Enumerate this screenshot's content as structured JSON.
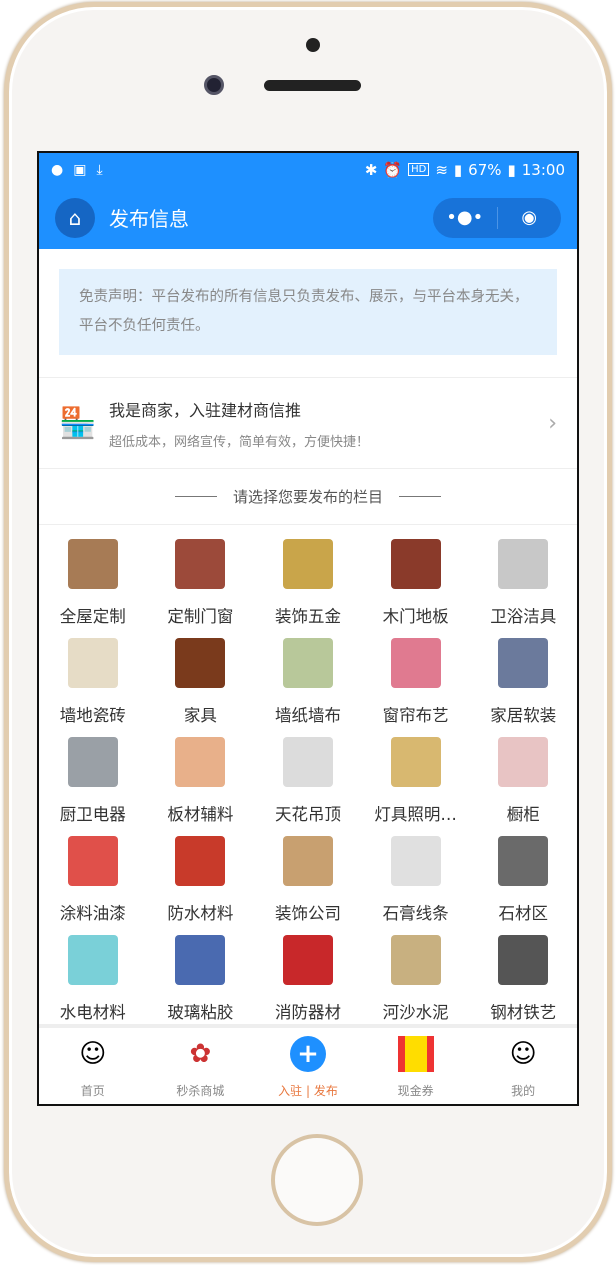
{
  "status": {
    "time": "13:00",
    "battery": "67%",
    "icons": [
      "wechat-icon",
      "image-icon",
      "download-icon",
      "bluetooth-icon",
      "alarm-icon",
      "hd-icon",
      "wifi-icon",
      "signal-icon",
      "battery-icon"
    ]
  },
  "nav": {
    "title": "发布信息",
    "more": "•●•",
    "target": "◉"
  },
  "disclaimer": "免责声明：平台发布的所有信息只负责发布、展示，与平台本身无关，平台不负任何责任。",
  "merchant": {
    "title": "我是商家，入驻建材商信推",
    "subtitle": "超低成本，网络宣传，简单有效，方便快捷！"
  },
  "section_title": "请选择您要发布的栏目",
  "categories": [
    {
      "label": "全屋定制",
      "color": "#a77b55"
    },
    {
      "label": "定制门窗",
      "color": "#9c4a3a"
    },
    {
      "label": "装饰五金",
      "color": "#c9a54a"
    },
    {
      "label": "木门地板",
      "color": "#8a3a2a"
    },
    {
      "label": "卫浴洁具",
      "color": "#c8c8c8"
    },
    {
      "label": "墙地瓷砖",
      "color": "#e6dcc6"
    },
    {
      "label": "家具",
      "color": "#7a3a1c"
    },
    {
      "label": "墙纸墙布",
      "color": "#b8c89a"
    },
    {
      "label": "窗帘布艺",
      "color": "#e07a90"
    },
    {
      "label": "家居软装",
      "color": "#6b7a9c"
    },
    {
      "label": "厨卫电器",
      "color": "#9aa0a6"
    },
    {
      "label": "板材辅料",
      "color": "#e8b08a"
    },
    {
      "label": "天花吊顶",
      "color": "#dcdcdc"
    },
    {
      "label": "灯具照明…",
      "color": "#d8b870"
    },
    {
      "label": "橱柜",
      "color": "#e8c4c4"
    },
    {
      "label": "涂料油漆",
      "color": "#e0504a"
    },
    {
      "label": "防水材料",
      "color": "#c83a2a"
    },
    {
      "label": "装饰公司",
      "color": "#c8a070"
    },
    {
      "label": "石膏线条",
      "color": "#e0e0e0"
    },
    {
      "label": "石材区",
      "color": "#6a6a6a"
    },
    {
      "label": "水电材料",
      "color": "#7ad0d8"
    },
    {
      "label": "玻璃粘胶",
      "color": "#4a6ab0"
    },
    {
      "label": "消防器材",
      "color": "#c8282a"
    },
    {
      "label": "河沙水泥",
      "color": "#c8b080"
    },
    {
      "label": "钢材铁艺",
      "color": "#555555"
    }
  ],
  "tabs": [
    {
      "label": "首页",
      "icon": "ghost-icon",
      "active": false
    },
    {
      "label": "秒杀商城",
      "icon": "mall-icon",
      "active": false
    },
    {
      "label": "入驻 | 发布",
      "icon": "plus-icon",
      "active": true
    },
    {
      "label": "现金券",
      "icon": "coupon-icon",
      "active": false
    },
    {
      "label": "我的",
      "icon": "smile-icon",
      "active": false
    }
  ],
  "colors": {
    "primary": "#1e90ff",
    "active_tab": "#e8773e"
  }
}
